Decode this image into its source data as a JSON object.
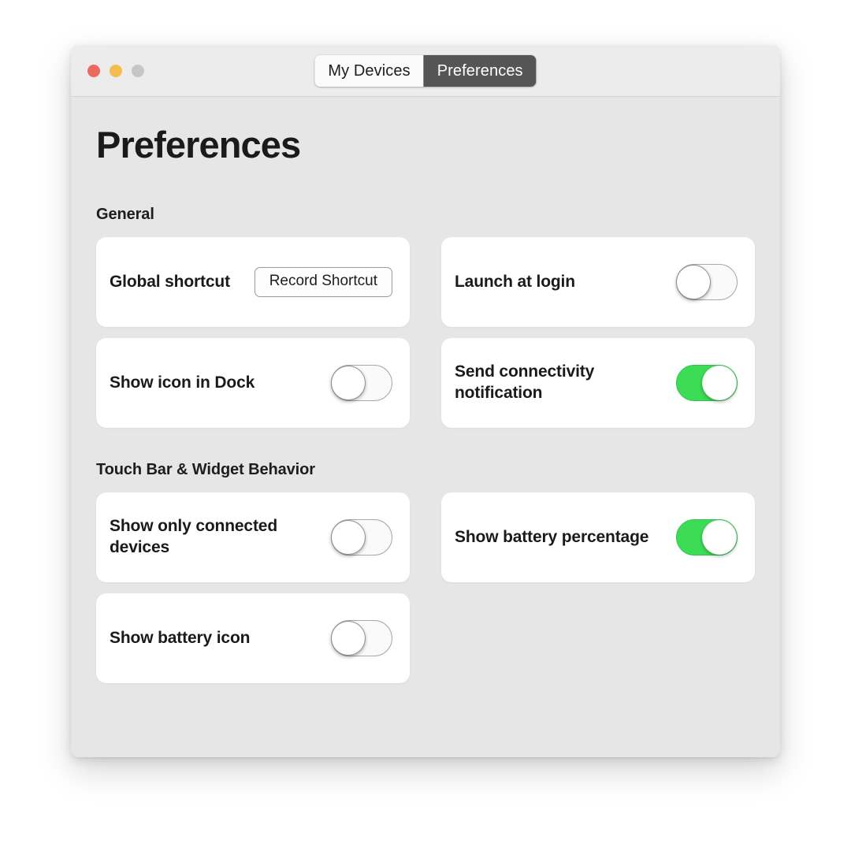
{
  "window": {
    "traffic_lights": [
      {
        "name": "close",
        "color": "#ed6a5e"
      },
      {
        "name": "minimize",
        "color": "#f5bd4f"
      },
      {
        "name": "zoom",
        "color": "#c6c6c6"
      }
    ],
    "tabs": [
      {
        "label": "My Devices",
        "selected": false
      },
      {
        "label": "Preferences",
        "selected": true
      }
    ]
  },
  "page": {
    "title": "Preferences"
  },
  "sections": [
    {
      "label": "General",
      "cards": [
        {
          "label": "Global shortcut",
          "control": "button",
          "button_label": "Record Shortcut"
        },
        {
          "label": "Launch at login",
          "control": "toggle",
          "value": "off"
        },
        {
          "label": "Show icon in Dock",
          "control": "toggle",
          "value": "off"
        },
        {
          "label": "Send connectivity notification",
          "control": "toggle",
          "value": "on"
        }
      ]
    },
    {
      "label": "Touch Bar & Widget Behavior",
      "cards": [
        {
          "label": "Show only connected devices",
          "control": "toggle",
          "value": "off"
        },
        {
          "label": "Show battery percentage",
          "control": "toggle",
          "value": "on"
        },
        {
          "label": "Show battery icon",
          "control": "toggle",
          "value": "off"
        }
      ]
    }
  ],
  "colors": {
    "toggle_on": "#3ddc56",
    "tab_selected_bg": "#555555",
    "window_bg": "#e6e6e6",
    "card_bg": "#ffffff"
  }
}
